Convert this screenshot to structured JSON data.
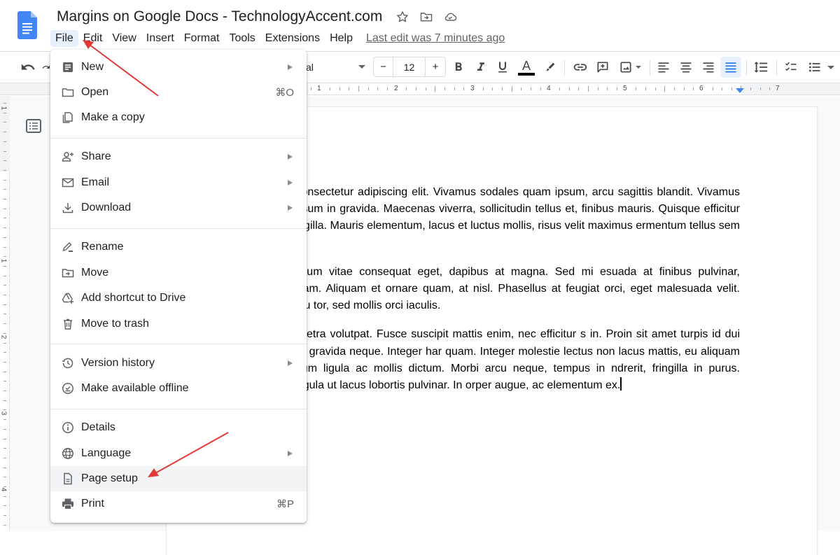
{
  "header": {
    "title": "Margins on Google Docs - TechnologyAccent.com",
    "icons": [
      "star-icon",
      "move-to-folder-icon",
      "cloud-saved-icon"
    ],
    "last_edit": "Last edit was 7 minutes ago"
  },
  "menubar": {
    "items": [
      {
        "label": "File",
        "active": true
      },
      {
        "label": "Edit"
      },
      {
        "label": "View"
      },
      {
        "label": "Insert"
      },
      {
        "label": "Format"
      },
      {
        "label": "Tools"
      },
      {
        "label": "Extensions"
      },
      {
        "label": "Help"
      }
    ]
  },
  "toolbar": {
    "font_name": "Arial",
    "font_name_visible": "al",
    "font_size": "12",
    "minus": "−",
    "plus": "+",
    "text_color": "#000000",
    "active_alignment": "justify",
    "accent_color": "#1a73e8"
  },
  "ruler": {
    "numbers": [
      "1",
      "2",
      "3",
      "4",
      "5",
      "6",
      "7"
    ],
    "vertical_numbers": [
      "1",
      "1",
      "2",
      "3",
      "4"
    ]
  },
  "file_menu": {
    "groups": [
      [
        {
          "label": "New",
          "icon": "document-icon",
          "submenu": true
        },
        {
          "label": "Open",
          "icon": "folder-icon",
          "shortcut": "⌘O"
        },
        {
          "label": "Make a copy",
          "icon": "copy-icon"
        }
      ],
      [
        {
          "label": "Share",
          "icon": "add-person-icon",
          "submenu": true
        },
        {
          "label": "Email",
          "icon": "email-icon",
          "submenu": true
        },
        {
          "label": "Download",
          "icon": "download-icon",
          "submenu": true
        }
      ],
      [
        {
          "label": "Rename",
          "icon": "rename-icon"
        },
        {
          "label": "Move",
          "icon": "move-folder-icon"
        },
        {
          "label": "Add shortcut to Drive",
          "icon": "drive-shortcut-icon"
        },
        {
          "label": "Move to trash",
          "icon": "trash-icon"
        }
      ],
      [
        {
          "label": "Version history",
          "icon": "history-icon",
          "submenu": true
        },
        {
          "label": "Make available offline",
          "icon": "offline-icon"
        }
      ],
      [
        {
          "label": "Details",
          "icon": "info-icon"
        },
        {
          "label": "Language",
          "icon": "globe-icon",
          "submenu": true
        },
        {
          "label": "Page setup",
          "icon": "page-icon",
          "highlighted": true
        },
        {
          "label": "Print",
          "icon": "print-icon",
          "shortcut": "⌘P"
        }
      ]
    ]
  },
  "document": {
    "paragraphs": [
      "m dolor sit amet, consectetur adipiscing elit. Vivamus sodales quam ipsum, arcu sagittis blandit. Vivamus tempor maximus ipsum in gravida. Maecenas viverra, sollicitudin tellus et, finibus mauris. Quisque efficitur ipsum sit amet r fringilla. Mauris elementum, lacus et luctus mollis, risus velit maximus ermentum tellus sem non nulla.",
      "cus turpis, elementum vitae consequat eget, dapibus at magna. Sed mi esuada at finibus pulvinar, scelerisque nec quam. Aliquam et ornare quam, at nisl. Phasellus at feugiat orci, eget malesuada velit. Proin aliquet nulla eu tor, sed mollis orci iaculis.",
      "ugiat velit eget pharetra volutpat. Fusce suscipit mattis enim, nec efficitur s in. Proin sit amet turpis id dui vehicula pulvinar eu gravida neque. Integer har quam. Integer molestie lectus non lacus mattis, eu aliquam urna In condimentum ligula ac mollis dictum. Morbi arcu neque, tempus in ndrerit, fringilla in purus. Suspendisse eget ligula ut lacus lobortis pulvinar. In orper augue, ac elementum ex."
    ],
    "paragraph_lines": [
      [
        "m dolor sit amet, consectetur adipiscing elit. Vivamus sodales quam ipsum,",
        "arcu sagittis blandit. Vivamus tempor maximus ipsum in gravida. Maecenas",
        "viverra, sollicitudin tellus et, finibus mauris. Quisque efficitur ipsum sit amet",
        "r fringilla. Mauris elementum, lacus et luctus mollis, risus velit maximus",
        "ermentum tellus sem non nulla."
      ],
      [
        "cus turpis, elementum vitae consequat eget, dapibus at magna. Sed mi",
        "esuada at finibus pulvinar, scelerisque nec quam. Aliquam et ornare quam, at",
        "nisl. Phasellus at feugiat orci, eget malesuada velit. Proin aliquet nulla eu",
        "tor, sed mollis orci iaculis."
      ],
      [
        "ugiat velit eget pharetra volutpat. Fusce suscipit mattis enim, nec efficitur",
        "s in. Proin sit amet turpis id dui vehicula pulvinar eu gravida neque. Integer",
        "har quam. Integer molestie lectus non lacus mattis, eu aliquam urna",
        "In condimentum ligula ac mollis dictum. Morbi arcu neque, tempus in",
        "ndrerit, fringilla in purus. Suspendisse eget ligula ut lacus lobortis pulvinar. In",
        "orper augue, ac elementum ex."
      ]
    ]
  },
  "annotations": {
    "arrow_color": "#e53935",
    "targets": [
      "File",
      "Page setup"
    ]
  }
}
